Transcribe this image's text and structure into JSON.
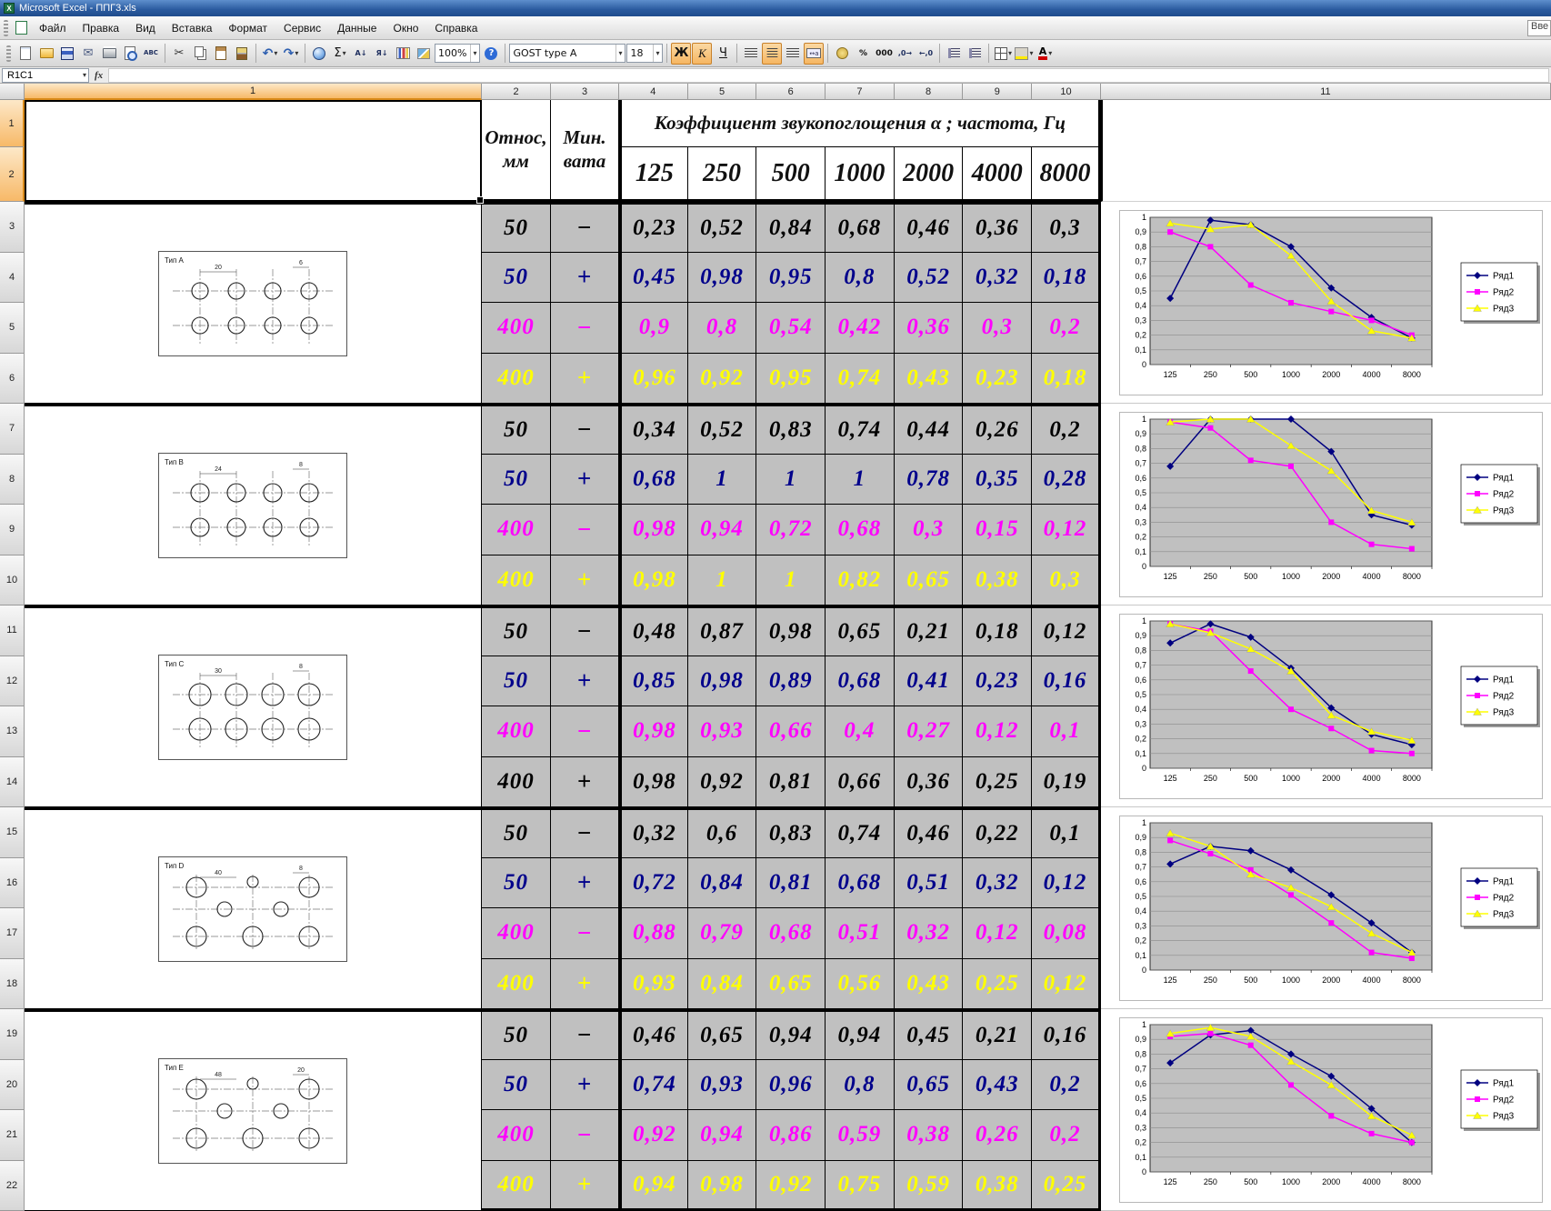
{
  "window": {
    "title": "Microsoft Excel - ППГ3.xls"
  },
  "menu": {
    "items": [
      "Файл",
      "Правка",
      "Вид",
      "Вставка",
      "Формат",
      "Сервис",
      "Данные",
      "Окно",
      "Справка"
    ],
    "question_text": "Вве"
  },
  "toolbar": {
    "zoom_value": "100%",
    "font_name": "GOST type A",
    "font_size": "18",
    "bold_label": "Ж",
    "italic_label": "К",
    "underline_label": "Ч",
    "sum_label": "Σ",
    "percent_label": "%",
    "thousands_label": "000",
    "sort_asc_label": "А↓",
    "sort_desc_label": "Я↓"
  },
  "formula_bar": {
    "name_box": "R1C1",
    "fx_label": "fx"
  },
  "sheet": {
    "col_headers": [
      "1",
      "2",
      "3",
      "4",
      "5",
      "6",
      "7",
      "8",
      "9",
      "10",
      "11"
    ],
    "row_count": 22,
    "header": {
      "relative_col": "Относ,\nмм",
      "wool_col": "Мин.\nвата",
      "title": "Коэффициент звукопоглощения α ; частота, Гц",
      "frequencies": [
        "125",
        "250",
        "500",
        "1000",
        "2000",
        "4000",
        "8000"
      ]
    },
    "blocks": [
      {
        "type_label": "Тип A",
        "dims": [
          "20",
          "6"
        ],
        "rows": [
          {
            "thickness": "50",
            "wool": "−",
            "color": "black",
            "values": [
              "0,23",
              "0,52",
              "0,84",
              "0,68",
              "0,46",
              "0,36",
              "0,3"
            ]
          },
          {
            "thickness": "50",
            "wool": "+",
            "color": "navy",
            "values": [
              "0,45",
              "0,98",
              "0,95",
              "0,8",
              "0,52",
              "0,32",
              "0,18"
            ]
          },
          {
            "thickness": "400",
            "wool": "−",
            "color": "magenta",
            "values": [
              "0,9",
              "0,8",
              "0,54",
              "0,42",
              "0,36",
              "0,3",
              "0,2"
            ]
          },
          {
            "thickness": "400",
            "wool": "+",
            "color": "yellow",
            "values": [
              "0,96",
              "0,92",
              "0,95",
              "0,74",
              "0,43",
              "0,23",
              "0,18"
            ]
          }
        ]
      },
      {
        "type_label": "Тип B",
        "dims": [
          "24",
          "8"
        ],
        "rows": [
          {
            "thickness": "50",
            "wool": "−",
            "color": "black",
            "values": [
              "0,34",
              "0,52",
              "0,83",
              "0,74",
              "0,44",
              "0,26",
              "0,2"
            ]
          },
          {
            "thickness": "50",
            "wool": "+",
            "color": "navy",
            "values": [
              "0,68",
              "1",
              "1",
              "1",
              "0,78",
              "0,35",
              "0,28"
            ]
          },
          {
            "thickness": "400",
            "wool": "−",
            "color": "magenta",
            "values": [
              "0,98",
              "0,94",
              "0,72",
              "0,68",
              "0,3",
              "0,15",
              "0,12"
            ]
          },
          {
            "thickness": "400",
            "wool": "+",
            "color": "yellow",
            "values": [
              "0,98",
              "1",
              "1",
              "0,82",
              "0,65",
              "0,38",
              "0,3"
            ]
          }
        ]
      },
      {
        "type_label": "Тип C",
        "dims": [
          "30",
          "8"
        ],
        "rows": [
          {
            "thickness": "50",
            "wool": "−",
            "color": "black",
            "values": [
              "0,48",
              "0,87",
              "0,98",
              "0,65",
              "0,21",
              "0,18",
              "0,12"
            ]
          },
          {
            "thickness": "50",
            "wool": "+",
            "color": "navy",
            "values": [
              "0,85",
              "0,98",
              "0,89",
              "0,68",
              "0,41",
              "0,23",
              "0,16"
            ]
          },
          {
            "thickness": "400",
            "wool": "−",
            "color": "magenta",
            "values": [
              "0,98",
              "0,93",
              "0,66",
              "0,4",
              "0,27",
              "0,12",
              "0,1"
            ]
          },
          {
            "thickness": "400",
            "wool": "+",
            "color": "black",
            "values": [
              "0,98",
              "0,92",
              "0,81",
              "0,66",
              "0,36",
              "0,25",
              "0,19"
            ]
          }
        ]
      },
      {
        "type_label": "Тип D",
        "dims": [
          "40",
          "8"
        ],
        "rows": [
          {
            "thickness": "50",
            "wool": "−",
            "color": "black",
            "values": [
              "0,32",
              "0,6",
              "0,83",
              "0,74",
              "0,46",
              "0,22",
              "0,1"
            ]
          },
          {
            "thickness": "50",
            "wool": "+",
            "color": "navy",
            "values": [
              "0,72",
              "0,84",
              "0,81",
              "0,68",
              "0,51",
              "0,32",
              "0,12"
            ]
          },
          {
            "thickness": "400",
            "wool": "−",
            "color": "magenta",
            "values": [
              "0,88",
              "0,79",
              "0,68",
              "0,51",
              "0,32",
              "0,12",
              "0,08"
            ]
          },
          {
            "thickness": "400",
            "wool": "+",
            "color": "yellow",
            "values": [
              "0,93",
              "0,84",
              "0,65",
              "0,56",
              "0,43",
              "0,25",
              "0,12"
            ]
          }
        ]
      },
      {
        "type_label": "Тип E",
        "dims": [
          "48",
          "20"
        ],
        "rows": [
          {
            "thickness": "50",
            "wool": "−",
            "color": "black",
            "values": [
              "0,46",
              "0,65",
              "0,94",
              "0,94",
              "0,45",
              "0,21",
              "0,16"
            ]
          },
          {
            "thickness": "50",
            "wool": "+",
            "color": "navy",
            "values": [
              "0,74",
              "0,93",
              "0,96",
              "0,8",
              "0,65",
              "0,43",
              "0,2"
            ]
          },
          {
            "thickness": "400",
            "wool": "−",
            "color": "magenta",
            "values": [
              "0,92",
              "0,94",
              "0,86",
              "0,59",
              "0,38",
              "0,26",
              "0,2"
            ]
          },
          {
            "thickness": "400",
            "wool": "+",
            "color": "yellow",
            "values": [
              "0,94",
              "0,98",
              "0,92",
              "0,75",
              "0,59",
              "0,38",
              "0,25"
            ]
          }
        ]
      }
    ]
  },
  "chart_data": [
    {
      "type": "line",
      "x": [
        "125",
        "250",
        "500",
        "1000",
        "2000",
        "4000",
        "8000"
      ],
      "ylim": [
        0,
        1
      ],
      "y_ticks": [
        "0",
        "0,1",
        "0,2",
        "0,3",
        "0,4",
        "0,5",
        "0,6",
        "0,7",
        "0,8",
        "0,9",
        "1"
      ],
      "legend_position": "right",
      "series": [
        {
          "name": "Ряд1",
          "color": "#000080",
          "marker": "diamond",
          "values": [
            0.45,
            0.98,
            0.95,
            0.8,
            0.52,
            0.32,
            0.18
          ]
        },
        {
          "name": "Ряд2",
          "color": "#ff00ff",
          "marker": "square",
          "values": [
            0.9,
            0.8,
            0.54,
            0.42,
            0.36,
            0.3,
            0.2
          ]
        },
        {
          "name": "Ряд3",
          "color": "#ffff00",
          "marker": "triangle",
          "values": [
            0.96,
            0.92,
            0.95,
            0.74,
            0.43,
            0.23,
            0.18
          ]
        }
      ]
    },
    {
      "type": "line",
      "x": [
        "125",
        "250",
        "500",
        "1000",
        "2000",
        "4000",
        "8000"
      ],
      "ylim": [
        0,
        1
      ],
      "y_ticks": [
        "0",
        "0,1",
        "0,2",
        "0,3",
        "0,4",
        "0,5",
        "0,6",
        "0,7",
        "0,8",
        "0,9",
        "1"
      ],
      "legend_position": "right",
      "series": [
        {
          "name": "Ряд1",
          "color": "#000080",
          "marker": "diamond",
          "values": [
            0.68,
            1,
            1,
            1,
            0.78,
            0.35,
            0.28
          ]
        },
        {
          "name": "Ряд2",
          "color": "#ff00ff",
          "marker": "square",
          "values": [
            0.98,
            0.94,
            0.72,
            0.68,
            0.3,
            0.15,
            0.12
          ]
        },
        {
          "name": "Ряд3",
          "color": "#ffff00",
          "marker": "triangle",
          "values": [
            0.98,
            1,
            1,
            0.82,
            0.65,
            0.38,
            0.3
          ]
        }
      ]
    },
    {
      "type": "line",
      "x": [
        "125",
        "250",
        "500",
        "1000",
        "2000",
        "4000",
        "8000"
      ],
      "ylim": [
        0,
        1
      ],
      "y_ticks": [
        "0",
        "0,1",
        "0,2",
        "0,3",
        "0,4",
        "0,5",
        "0,6",
        "0,7",
        "0,8",
        "0,9",
        "1"
      ],
      "legend_position": "right",
      "series": [
        {
          "name": "Ряд1",
          "color": "#000080",
          "marker": "diamond",
          "values": [
            0.85,
            0.98,
            0.89,
            0.68,
            0.41,
            0.23,
            0.16
          ]
        },
        {
          "name": "Ряд2",
          "color": "#ff00ff",
          "marker": "square",
          "values": [
            0.98,
            0.93,
            0.66,
            0.4,
            0.27,
            0.12,
            0.1
          ]
        },
        {
          "name": "Ряд3",
          "color": "#ffff00",
          "marker": "triangle",
          "values": [
            0.98,
            0.92,
            0.81,
            0.66,
            0.36,
            0.25,
            0.19
          ]
        }
      ]
    },
    {
      "type": "line",
      "x": [
        "125",
        "250",
        "500",
        "1000",
        "2000",
        "4000",
        "8000"
      ],
      "ylim": [
        0,
        1
      ],
      "y_ticks": [
        "0",
        "0,1",
        "0,2",
        "0,3",
        "0,4",
        "0,5",
        "0,6",
        "0,7",
        "0,8",
        "0,9",
        "1"
      ],
      "legend_position": "right",
      "series": [
        {
          "name": "Ряд1",
          "color": "#000080",
          "marker": "diamond",
          "values": [
            0.72,
            0.84,
            0.81,
            0.68,
            0.51,
            0.32,
            0.12
          ]
        },
        {
          "name": "Ряд2",
          "color": "#ff00ff",
          "marker": "square",
          "values": [
            0.88,
            0.79,
            0.68,
            0.51,
            0.32,
            0.12,
            0.08
          ]
        },
        {
          "name": "Ряд3",
          "color": "#ffff00",
          "marker": "triangle",
          "values": [
            0.93,
            0.84,
            0.65,
            0.56,
            0.43,
            0.25,
            0.12
          ]
        }
      ]
    },
    {
      "type": "line",
      "x": [
        "125",
        "250",
        "500",
        "1000",
        "2000",
        "4000",
        "8000"
      ],
      "ylim": [
        0,
        1
      ],
      "y_ticks": [
        "0",
        "0,1",
        "0,2",
        "0,3",
        "0,4",
        "0,5",
        "0,6",
        "0,7",
        "0,8",
        "0,9",
        "1"
      ],
      "legend_position": "right",
      "series": [
        {
          "name": "Ряд1",
          "color": "#000080",
          "marker": "diamond",
          "values": [
            0.74,
            0.93,
            0.96,
            0.8,
            0.65,
            0.43,
            0.2
          ]
        },
        {
          "name": "Ряд2",
          "color": "#ff00ff",
          "marker": "square",
          "values": [
            0.92,
            0.94,
            0.86,
            0.59,
            0.38,
            0.26,
            0.2
          ]
        },
        {
          "name": "Ряд3",
          "color": "#ffff00",
          "marker": "triangle",
          "values": [
            0.94,
            0.98,
            0.92,
            0.75,
            0.59,
            0.38,
            0.25
          ]
        }
      ]
    }
  ]
}
